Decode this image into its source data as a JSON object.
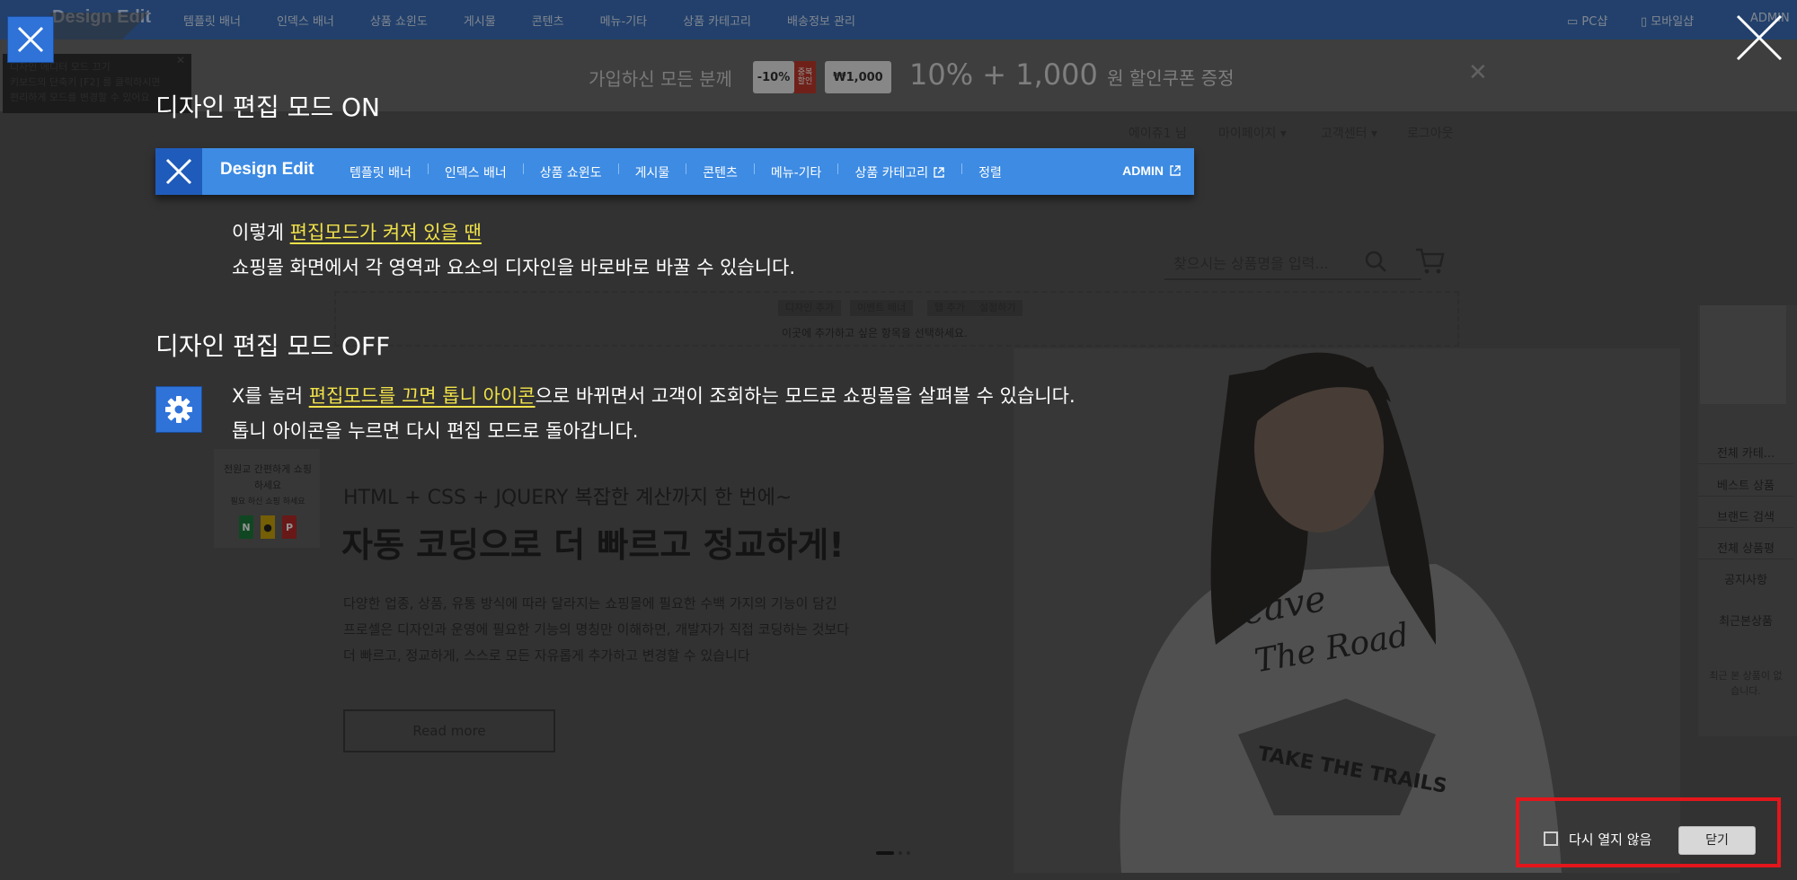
{
  "background": {
    "topbar": {
      "brand": "Design Edit",
      "nav": [
        "템플릿 배너",
        "인덱스 배너",
        "상품 쇼윈도",
        "게시물",
        "콘텐츠",
        "메뉴-기타",
        "상품 카테고리",
        "배송정보 관리"
      ],
      "pc_label": "PC샵",
      "mobile_label": "모바일샵",
      "admin_label": "ADMIN"
    },
    "promo": {
      "lead": "가입하신 모든 분께",
      "chip1": "-10%",
      "chip1_tag": "중복 할인",
      "chip2": "₩1,000",
      "headline": "10% + 1,000",
      "headline_suffix": "원 할인쿠폰 증정"
    },
    "account_menu": {
      "greeting": "에이쥬1 님",
      "mypage": "마이페이지 ▾",
      "support": "고객센터 ▾",
      "logout": "로그아웃"
    },
    "search_placeholder": "찾으시는 상품명을 입력...",
    "edit_area": {
      "buttons": [
        "디자인 추가",
        "이벤트 배너",
        "탭 추가",
        "설정하기"
      ],
      "hint": "이곳에 추가하고 싶은 항목을 선택하세요."
    },
    "hero": {
      "subtitle": "HTML + CSS + JQUERY 복잡한 계산까지 한 번에~",
      "title": "자동 코딩으로 더 빠르고 정교하게!",
      "body": [
        "다양한 업종, 상품, 유통 방식에 따라 달라지는 쇼핑몰에 필요한 수백 가지의 기능이 담긴",
        "프로셀은 디자인과 운영에 필요한 기능의 명칭만 이해하면, 개발자가 직접 코딩하는 것보다",
        "더 빠르고, 정교하게, 스스로 모든 자유롭게 추가하고 변경할 수 있습니다"
      ],
      "read_more": "Read more",
      "tshirt_text": "TAKE THE TRAILS"
    },
    "sidebar": {
      "items": [
        "전체 카테...",
        "베스트 상품",
        "브랜드 검색",
        "전체 상품평",
        "공지사항",
        "최근본상품"
      ],
      "empty_text": "최근 본 상품이 없습니다."
    },
    "left_card": {
      "text": "전원교 간편하게 쇼핑하세요",
      "sub": "필요 하신 쇼핑 하세요",
      "letters": [
        "N",
        "●",
        "P"
      ]
    },
    "tooltip": [
      "디자인 에디터 모드 끄기",
      "키보드의 단축키 [F2] 를 클릭하시면",
      "편리하게 모드를 변경할 수 있어요"
    ]
  },
  "overlay": {
    "on_heading": "디자인 편집 모드 ON",
    "bar": {
      "brand": "Design Edit",
      "nav": [
        "템플릿 배너",
        "인덱스 배너",
        "상품 쇼윈도",
        "게시물",
        "콘텐츠",
        "메뉴-기타",
        "상품 카테고리",
        "정렬"
      ],
      "admin": "ADMIN"
    },
    "on_desc": {
      "line1_prefix": "이렇게 ",
      "line1_highlight": "편집모드가 켜져 있을 땐",
      "line2": "쇼핑몰 화면에서 각 영역과 요소의 디자인을 바로바로 바꿀 수 있습니다."
    },
    "off_heading": "디자인 편집 모드 OFF",
    "off_desc": {
      "line1_prefix": "X를 눌러 ",
      "line1_highlight": "편집모드를 끄면 톱니 아이콘",
      "line1_suffix": "으로 바뀌면서 고객이 조회하는 모드로 쇼핑몰을 살펴볼 수 있습니다.",
      "line2": "톱니 아이콘을 누르면 다시 편집 모드로 돌아갑니다."
    },
    "footer": {
      "dont_show": "다시 열지 않음",
      "close": "닫기"
    }
  },
  "colors": {
    "accent_blue": "#3d8be3",
    "highlight_yellow": "#f1e24a",
    "frame_red": "#e3161c"
  },
  "icons": [
    "close-icon",
    "gear-icon",
    "external-link-icon",
    "search-icon",
    "cart-icon",
    "pc-icon",
    "mobile-icon"
  ]
}
